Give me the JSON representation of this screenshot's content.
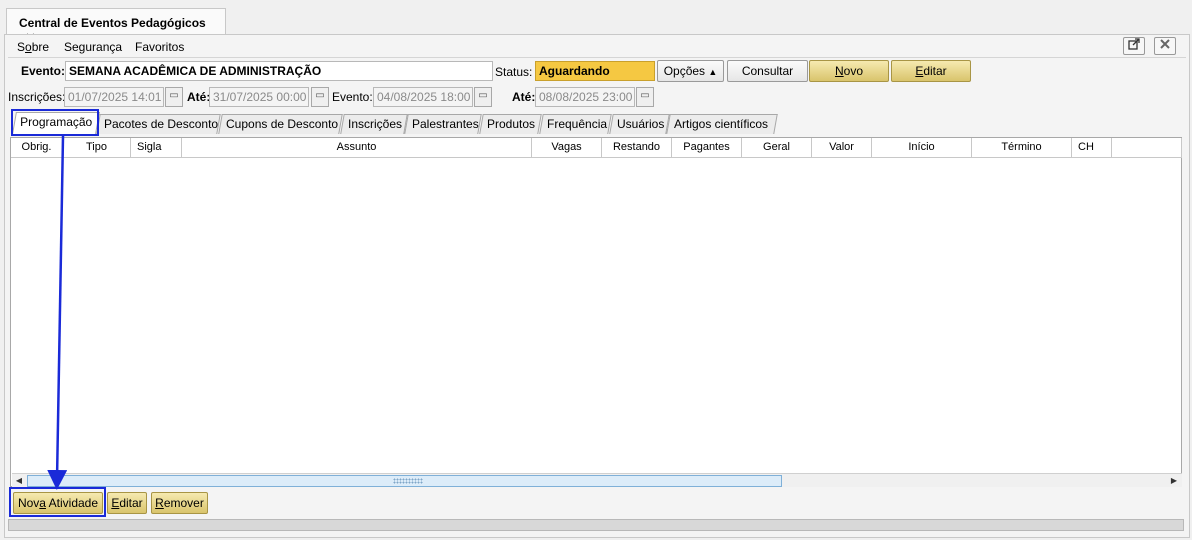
{
  "window": {
    "tab_title": "Central de Eventos Pedagógicos",
    "close_glyph": "✕"
  },
  "menu": {
    "items": [
      {
        "pre": "S",
        "u": "o",
        "post": "bre"
      },
      {
        "pre": "",
        "u": "",
        "post": "Segurança"
      },
      {
        "pre": "",
        "u": "",
        "post": "Favoritos"
      }
    ]
  },
  "header": {
    "evento_label": "Evento:",
    "evento_value": "SEMANA ACADÊMICA DE ADMINISTRAÇÃO",
    "status_label": "Status:",
    "status_value": "Aguardando",
    "opcoes_label": "Opções",
    "consultar_label": "Consultar",
    "novo_u": "N",
    "novo_rest": "ovo",
    "editar_u": "E",
    "editar_rest": "ditar"
  },
  "dates": {
    "inscricoes_label": "Inscrições:",
    "inscricoes_start": "01/07/2025 14:01",
    "ate1_label": "Até:",
    "inscricoes_end": "31/07/2025 00:00",
    "evento_label": "Evento:",
    "evento_start": "04/08/2025 18:00",
    "ate2_label": "Até:",
    "evento_end": "08/08/2025 23:00"
  },
  "tabs": [
    "Programação",
    "Pacotes de Desconto",
    "Cupons de Desconto",
    "Inscrições",
    "Palestrantes",
    "Produtos",
    "Frequência",
    "Usuários",
    "Artigos científicos"
  ],
  "grid": {
    "columns": [
      "Obrig.",
      "Tipo",
      "Sigla",
      "Assunto",
      "Vagas",
      "Restando",
      "Pagantes",
      "Geral",
      "Valor",
      "Início",
      "Término",
      "CH",
      ""
    ]
  },
  "actions": {
    "nova_pre": "Nov",
    "nova_u": "a",
    "nova_post": " Atividade",
    "editar_u": "E",
    "editar_rest": "ditar",
    "remover_u": "R",
    "remover_rest": "emover"
  },
  "colors": {
    "highlight": "#1a2ad8",
    "status_bg": "#f5c842",
    "button_gold": "#e8d88a"
  }
}
